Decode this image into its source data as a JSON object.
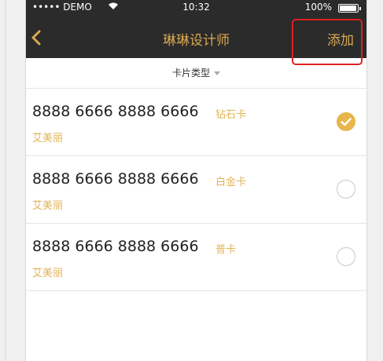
{
  "status_bar": {
    "carrier": "••••• DEMO",
    "time": "10:32",
    "battery": "100%"
  },
  "nav": {
    "title": "琳琳设计师",
    "add_label": "添加"
  },
  "filter": {
    "label": "卡片类型"
  },
  "cards": [
    {
      "number": "8888 6666 8888 6666",
      "type": "钻石卡",
      "owner": "艾美丽",
      "selected": true
    },
    {
      "number": "8888 6666 8888 6666",
      "type": "白金卡",
      "owner": "艾美丽",
      "selected": false
    },
    {
      "number": "8888 6666 8888 6666",
      "type": "普卡",
      "owner": "艾美丽",
      "selected": false
    }
  ],
  "colors": {
    "accent": "#d9aa50",
    "bar_bg": "#2b2b2b",
    "highlight": "#e02020"
  }
}
